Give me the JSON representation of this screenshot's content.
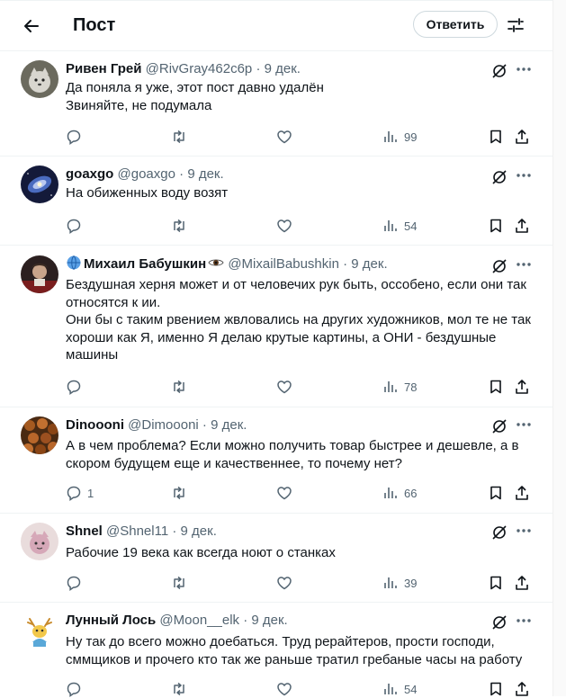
{
  "header": {
    "title": "Пост",
    "reply_label": "Ответить"
  },
  "tweets": [
    {
      "name": "Ривен Грей",
      "handle": "@RivGray462c6p",
      "date": "9 дек.",
      "lines": [
        "Да поняла я уже, этот пост давно удалён",
        "Звиняйте, не подумала"
      ],
      "replies": "",
      "views": "99"
    },
    {
      "name": "goaxgo",
      "handle": "@goaxgo",
      "date": "9 дек.",
      "lines": [
        "На обиженных воду возят"
      ],
      "replies": "",
      "views": "54"
    },
    {
      "name": "Михаил Бабушкин",
      "handle": "@MixailBabushkin",
      "date": "9 дек.",
      "lines": [
        "Бездушная херня может и от человечих рук быть, оссобено, если они так",
        "относятся к ии.",
        "Они бы с таким рвением жвловались на других художников, мол те не так",
        "хороши как Я, именно Я делаю крутые картины, а ОНИ - бездушные",
        "машины"
      ],
      "replies": "",
      "views": "78"
    },
    {
      "name": "Dinoooni",
      "handle": "@Dimoooni",
      "date": "9 дек.",
      "lines": [
        "А в чем проблема? Если можно получить товар быстрее и дешевле, а в",
        "скором будущем еще и качественнее, то почему нет?"
      ],
      "replies": "1",
      "views": "66"
    },
    {
      "name": "Shnel",
      "handle": "@Shnel11",
      "date": "9 дек.",
      "lines": [
        "Рабочие 19 века как всегда ноют о станках"
      ],
      "replies": "",
      "views": "39"
    },
    {
      "name": "Лунный Лось",
      "handle": "@Moon__elk",
      "date": "9 дек.",
      "lines": [
        "Ну так до всего можно доебаться. Труд рерайтеров, прости господи,",
        "сммщиков и прочего кто так же раньше тратил гребаные часы на работу"
      ],
      "replies": "",
      "views": "54"
    }
  ],
  "colors": {
    "text": "#0f1419",
    "secondary": "#536471",
    "border": "#eff3f4"
  },
  "icons": [
    "back-arrow-icon",
    "filter-icon",
    "grok-icon",
    "more-icon",
    "reply-icon",
    "retweet-icon",
    "like-icon",
    "views-icon",
    "bookmark-icon",
    "share-icon",
    "globe-icon",
    "eye-icon"
  ]
}
